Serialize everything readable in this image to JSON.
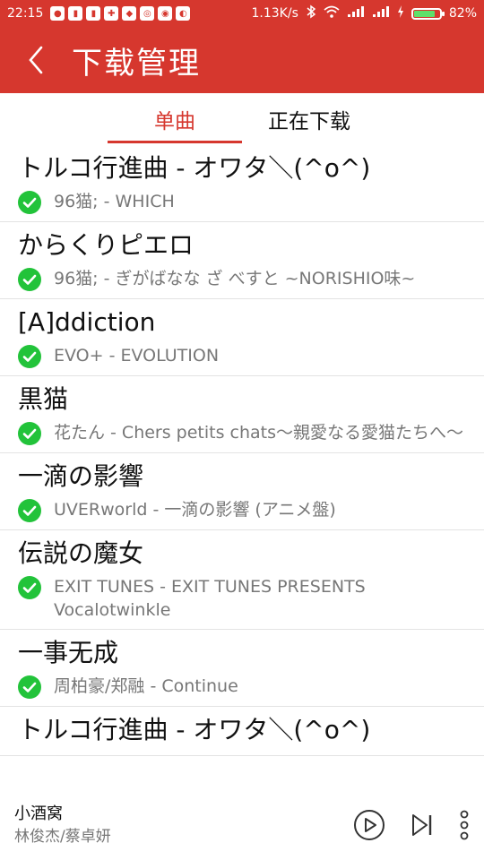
{
  "status_bar": {
    "time": "22:15",
    "network_speed": "1.13K/s",
    "battery_percent": "82%",
    "battery_level": 0.82,
    "notification_icons": [
      "penguin-icon",
      "notes-icon",
      "app-icon",
      "gift-icon",
      "drop-icon",
      "alarm-icon",
      "reader-icon",
      "android-icon"
    ]
  },
  "app_bar": {
    "title": "下载管理",
    "back_icon": "back-arrow-icon"
  },
  "tabs": [
    {
      "label": "单曲",
      "active": true
    },
    {
      "label": "正在下载",
      "active": false
    }
  ],
  "songs": [
    {
      "title": "トルコ行進曲 - オワタ＼(^o^)",
      "meta": "96猫; - WHICH"
    },
    {
      "title": "からくりピエロ",
      "meta": "96猫; - ぎがばなな ざ べすと ~NORISHIO味~"
    },
    {
      "title": "[A]ddiction",
      "meta": "EVO+ - EVOLUTION"
    },
    {
      "title": "黒猫",
      "meta": "花たん - Chers petits chats～親愛なる愛猫たちへ～"
    },
    {
      "title": "一滴の影響",
      "meta": "UVERworld - 一滴の影響 (アニメ盤)"
    },
    {
      "title": "伝説の魔女",
      "meta": "EXIT TUNES - EXIT TUNES PRESENTS Vocalotwinkle"
    },
    {
      "title": "一事无成",
      "meta": "周柏豪/郑融 - Continue"
    },
    {
      "title": "トルコ行進曲 - オワタ＼(^o^)",
      "meta": ""
    }
  ],
  "player": {
    "title": "小酒窝",
    "artist": "林俊杰/蔡卓妍"
  },
  "colors": {
    "accent": "#d6372e",
    "check": "#22c33a",
    "text": "#111111",
    "muted": "#777777"
  }
}
